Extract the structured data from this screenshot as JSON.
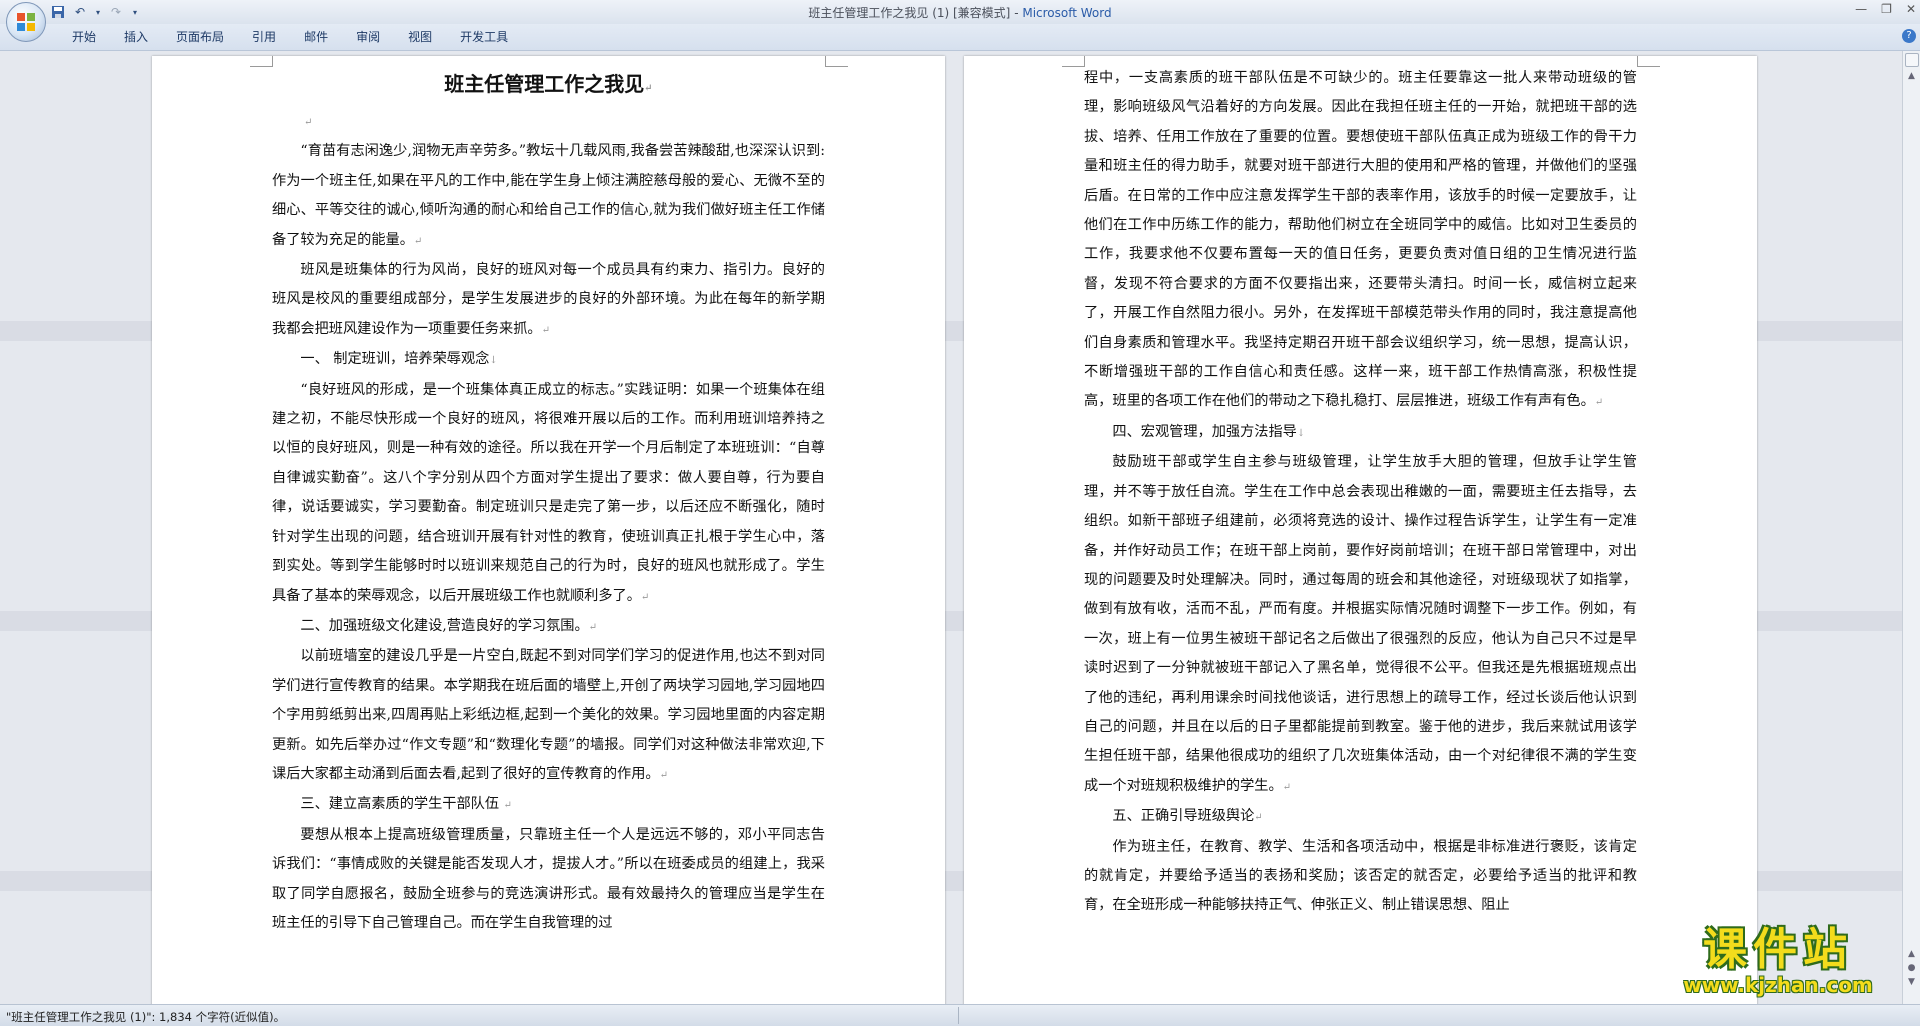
{
  "window": {
    "title_doc": "班主任管理工作之我见 (1) [兼容模式]",
    "title_sep": " - ",
    "title_app": "Microsoft Word"
  },
  "ribbon": {
    "tabs": [
      "开始",
      "插入",
      "页面布局",
      "引用",
      "邮件",
      "审阅",
      "视图",
      "开发工具"
    ]
  },
  "icons": {
    "office": "office-logo-icon",
    "save": "save-icon",
    "undo": "undo-icon",
    "redo": "redo-icon",
    "customize": "chevron-down-icon",
    "help": "help-icon"
  },
  "page1": {
    "title": "班主任管理工作之我见",
    "paragraphs": [
      "“育苗有志闲逸少,润物无声辛劳多。”教坛十几载风雨,我备尝苦辣酸甜,也深深认识到: 作为一个班主任,如果在平凡的工作中,能在学生身上倾注满腔慈母般的爱心、无微不至的细心、平等交往的诚心,倾听沟通的耐心和给自己工作的信心,就为我们做好班主任工作储备了较为充足的能量。",
      "班风是班集体的行为风尚，良好的班风对每一个成员具有约束力、指引力。良好的班风是校风的重要组成部分，是学生发展进步的良好的外部环境。为此在每年的新学期我都会把班风建设作为一项重要任务来抓。",
      "一、  制定班训，培养荣辱观念",
      "“良好班风的形成，是一个班集体真正成立的标志。”实践证明：如果一个班集体在组建之初，不能尽快形成一个良好的班风，将很难开展以后的工作。而利用班训培养持之以恒的良好班风，则是一种有效的途径。所以我在开学一个月后制定了本班班训：“自尊自律诚实勤奋”。这八个字分别从四个方面对学生提出了要求：做人要自尊，行为要自律，说话要诚实，学习要勤奋。制定班训只是走完了第一步，以后还应不断强化，随时针对学生出现的问题，结合班训开展有针对性的教育，使班训真正扎根于学生心中，落到实处。等到学生能够时时以班训来规范自己的行为时，良好的班风也就形成了。学生具备了基本的荣辱观念，以后开展班级工作也就顺利多了。",
      "二、加强班级文化建设,营造良好的学习氛围。",
      "以前班墙室的建设几乎是一片空白,既起不到对同学们学习的促进作用,也达不到对同学们进行宣传教育的结果。本学期我在班后面的墙壁上,开创了两块学习园地,学习园地四个字用剪纸剪出来,四周再贴上彩纸边框,起到一个美化的效果。学习园地里面的内容定期更新。如先后举办过“作文专题”和“数理化专题”的墙报。同学们对这种做法非常欢迎,下课后大家都主动涌到后面去看,起到了很好的宣传教育的作用。",
      "三、建立高素质的学生干部队伍",
      "要想从根本上提高班级管理质量，只靠班主任一个人是远远不够的，邓小平同志告诉我们：“事情成败的关键是能否发现人才，提拔人才。”所以在班委成员的组建上，我采取了同学自愿报名，鼓励全班参与的竞选演讲形式。最有效最持久的管理应当是学生在班主任的引导下自己管理自己。而在学生自我管理的过"
    ]
  },
  "page2": {
    "paragraphs": [
      "程中，一支高素质的班干部队伍是不可缺少的。班主任要靠这一批人来带动班级的管理，影响班级风气沿着好的方向发展。因此在我担任班主任的一开始，就把班干部的选拔、培养、任用工作放在了重要的位置。要想使班干部队伍真正成为班级工作的骨干力量和班主任的得力助手，就要对班干部进行大胆的使用和严格的管理，并做他们的坚强后盾。在日常的工作中应注意发挥学生干部的表率作用，该放手的时候一定要放手，让他们在工作中历练工作的能力，帮助他们树立在全班同学中的威信。比如对卫生委员的工作，我要求他不仅要布置每一天的值日任务，更要负责对值日组的卫生情况进行监督，发现不符合要求的方面不仅要指出来，还要带头清扫。时间一长，威信树立起来了，开展工作自然阻力很小。另外，在发挥班干部模范带头作用的同时，我注意提高他们自身素质和管理水平。我坚持定期召开班干部会议组织学习，统一思想，提高认识，不断增强班干部的工作自信心和责任感。这样一来，班干部工作热情高涨，积极性提高，班里的各项工作在他们的带动之下稳扎稳打、层层推进，班级工作有声有色。",
      "四、宏观管理，加强方法指导",
      "鼓励班干部或学生自主参与班级管理，让学生放手大胆的管理，但放手让学生管理，并不等于放任自流。学生在工作中总会表现出稚嫩的一面，需要班主任去指导，去组织。如新干部班子组建前，必须将竞选的设计、操作过程告诉学生，让学生有一定准备，并作好动员工作；在班干部上岗前，要作好岗前培训；在班干部日常管理中，对出现的问题要及时处理解决。同时，通过每周的班会和其他途径，对班级现状了如指掌，做到有放有收，活而不乱，严而有度。并根据实际情况随时调整下一步工作。例如，有一次，班上有一位男生被班干部记名之后做出了很强烈的反应，他认为自己只不过是早读时迟到了一分钟就被班干部记入了黑名单，觉得很不公平。但我还是先根据班规点出了他的违纪，再利用课余时间找他谈话，进行思想上的疏导工作，经过长谈后他认识到自己的问题，并且在以后的日子里都能提前到教室。鉴于他的进步，我后来就试用该学生担任班干部，结果他很成功的组织了几次班集体活动，由一个对纪律很不满的学生变成一个对班规积极维护的学生。",
      "五、正确引导班级舆论",
      "作为班主任，在教育、教学、生活和各项活动中，根据是非标准进行褒贬，该肯定的就肯定，并要给予适当的表扬和奖励；该否定的就否定，必要给予适当的批评和教育，在全班形成一种能够扶持正气、伸张正义、制止错误思想、阻止"
    ]
  },
  "marks": {
    "para": "↵",
    "line": "↓"
  },
  "statusbar": {
    "text": "\"班主任管理工作之我见 (1)\": 1,834 个字符(近似值)。"
  },
  "watermark": {
    "name": "课件站",
    "url": "www.kjzhan.com"
  }
}
